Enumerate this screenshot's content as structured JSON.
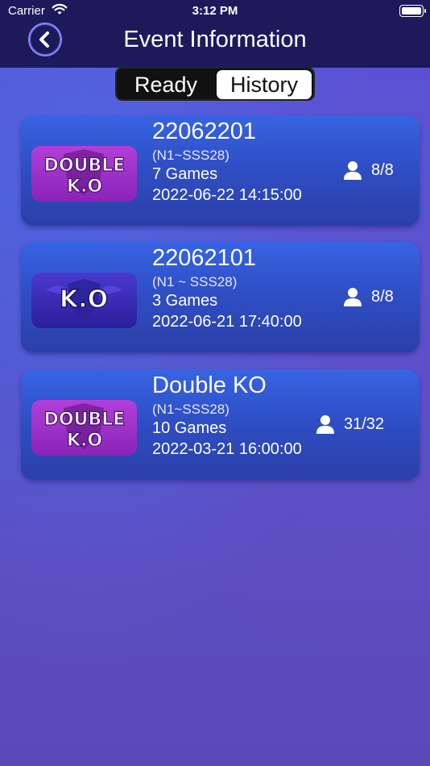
{
  "status_bar": {
    "carrier": "Carrier",
    "time": "3:12 PM"
  },
  "header": {
    "title": "Event Information",
    "back_icon": "chevron-left-icon"
  },
  "segment": {
    "ready_label": "Ready",
    "history_label": "History",
    "selected": "History"
  },
  "events": [
    {
      "badge": "DOUBLE K.O",
      "badge_lines": [
        "DOUBLE",
        "K.O"
      ],
      "badge_color": "#9a2fc7",
      "title": "22062201",
      "range": "(N1~SSS28)",
      "games": "7 Games",
      "date": "2022-06-22 14:15:00",
      "players": "8/8"
    },
    {
      "badge": "K.O",
      "badge_lines": [
        "K.O"
      ],
      "badge_color": "#3a2bb5",
      "title": "22062101",
      "range": "(N1 ~ SSS28)",
      "games": "3 Games",
      "date": "2022-06-21 17:40:00",
      "players": "8/8"
    },
    {
      "badge": "DOUBLE K.O",
      "badge_lines": [
        "DOUBLE",
        "K.O"
      ],
      "badge_color": "#9a2fc7",
      "title": "Double KO",
      "range": "(N1~SSS28)",
      "games": "10 Games",
      "date": "2022-03-21 16:00:00",
      "players": "31/32"
    }
  ],
  "colors": {
    "header_bg": "#1d1a5c",
    "card_top": "#3764e4",
    "card_bottom": "#2b3fa6"
  }
}
